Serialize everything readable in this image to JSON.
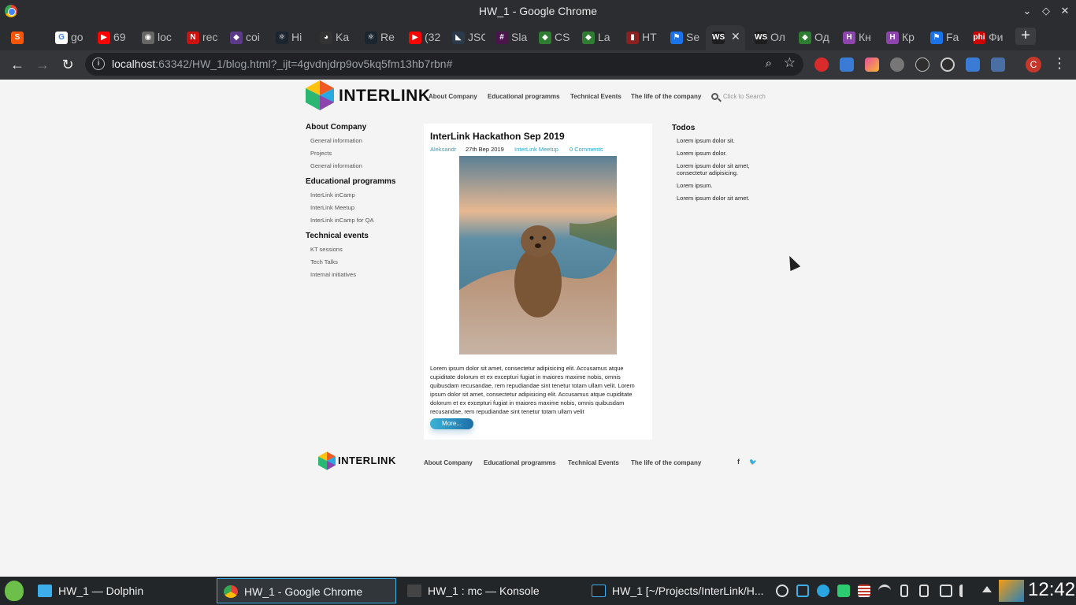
{
  "window": {
    "title": "HW_1 - Google Chrome"
  },
  "tabs": [
    {
      "label": "",
      "color": "#ff5500",
      "glyph": "S"
    },
    {
      "label": "go",
      "color": "#ffffff",
      "glyph": "G"
    },
    {
      "label": "69",
      "color": "#ff0000",
      "glyph": "▶"
    },
    {
      "label": "loc",
      "color": "#666666",
      "glyph": "◉"
    },
    {
      "label": "rec",
      "color": "#cc1111",
      "glyph": "N"
    },
    {
      "label": "coi",
      "color": "#5b3a8a",
      "glyph": "◆"
    },
    {
      "label": "Hi",
      "color": "#1a2530",
      "glyph": "⚛"
    },
    {
      "label": "Ka",
      "color": "#333333",
      "glyph": "◕"
    },
    {
      "label": "Re",
      "color": "#1a2530",
      "glyph": "⚛"
    },
    {
      "label": "(32",
      "color": "#ff0000",
      "glyph": "▶"
    },
    {
      "label": "JSC",
      "color": "#2a3a4a",
      "glyph": "◣"
    },
    {
      "label": "Sla",
      "color": "#4a154b",
      "glyph": "#"
    },
    {
      "label": "CS",
      "color": "#2f7d32",
      "glyph": "◆"
    },
    {
      "label": "La",
      "color": "#2f7d32",
      "glyph": "◆"
    },
    {
      "label": "HT",
      "color": "#8b2020",
      "glyph": "▮"
    },
    {
      "label": "Se",
      "color": "#1a73e8",
      "glyph": "⚑"
    },
    {
      "label": "",
      "color": "#1d1d1d",
      "glyph": "WS",
      "active": true
    },
    {
      "label": "Ол",
      "color": "#1d1d1d",
      "glyph": "WS"
    },
    {
      "label": "Од",
      "color": "#2f7d32",
      "glyph": "◆"
    },
    {
      "label": "Кн",
      "color": "#8e44ad",
      "glyph": "H"
    },
    {
      "label": "Кр",
      "color": "#8e44ad",
      "glyph": "H"
    },
    {
      "label": "Fa",
      "color": "#1a73e8",
      "glyph": "⚑"
    },
    {
      "label": "Фи",
      "color": "#cc0000",
      "glyph": "phi"
    }
  ],
  "omnibox": {
    "host": "localhost",
    "rest": ":63342/HW_1/blog.html?_ijt=4gvdnjdrp9ov5kq5fm13hb7rbn#"
  },
  "avatar": "C",
  "site": {
    "brand": "INTERLINK",
    "nav": [
      "About Company",
      "Educational programms",
      "Technical Events",
      "The life of the company"
    ],
    "search_placeholder": "Click to Search"
  },
  "sidebar": [
    {
      "heading": "About Company",
      "items": [
        "General information",
        "Projects",
        "General information"
      ]
    },
    {
      "heading": "Educational programms",
      "items": [
        "InterLink inCamp",
        "InterLink Meetup",
        "InterLink inCamp for QA"
      ]
    },
    {
      "heading": "Technical events",
      "items": [
        "KT sessions",
        "Tech Talks",
        "Internal initiatives"
      ]
    }
  ],
  "post": {
    "title": "InterLink Hackathon Sep 2019",
    "author": "Aleksandr",
    "date": "27th Bep 2019",
    "category": "InterLink Meetup",
    "comments": "0 Comments",
    "body": "Lorem ipsum dolor sit amet, consectetur adipisicing elit. Accusamus atque cupiditate dolorum et ex excepturi fugiat in maiores maxime nobis, omnis quibusdam recusandae, rem repudiandae sint tenetur totam ullam velit. Lorem ipsum dolor sit amet, consectetur adipisicing elit. Accusamus atque cupiditate dolorum et ex excepturi fugiat in maiores maxime nobis, omnis quibusdam recusandae, rem repudiandae sint tenetur totam ullam velit",
    "more_label": "More..."
  },
  "todos": {
    "heading": "Todos",
    "items": [
      "Lorem ipsum dolor sit.",
      "Lorem ipsum dolor.",
      "Lorem ipsum dolor sit amet, consectetur adipisicing.",
      "Lorem ipsum.",
      "Lorem ipsum dolor sit amet."
    ]
  },
  "footer": {
    "nav": [
      "About Company",
      "Educational programms",
      "Technical Events",
      "The life of the company"
    ],
    "facebook": "f",
    "twitter": "🐦"
  },
  "taskbar": {
    "tasks": [
      {
        "label": "HW_1 — Dolphin",
        "color": "#3daee9"
      },
      {
        "label": "HW_1 - Google Chrome",
        "color": "#4285f4",
        "active": true
      },
      {
        "label": "HW_1 : mc — Konsole",
        "color": "#444444"
      },
      {
        "label": "HW_1 [~/Projects/InterLink/H...",
        "color": "#1d1d1d"
      }
    ],
    "clock": "12:42"
  }
}
